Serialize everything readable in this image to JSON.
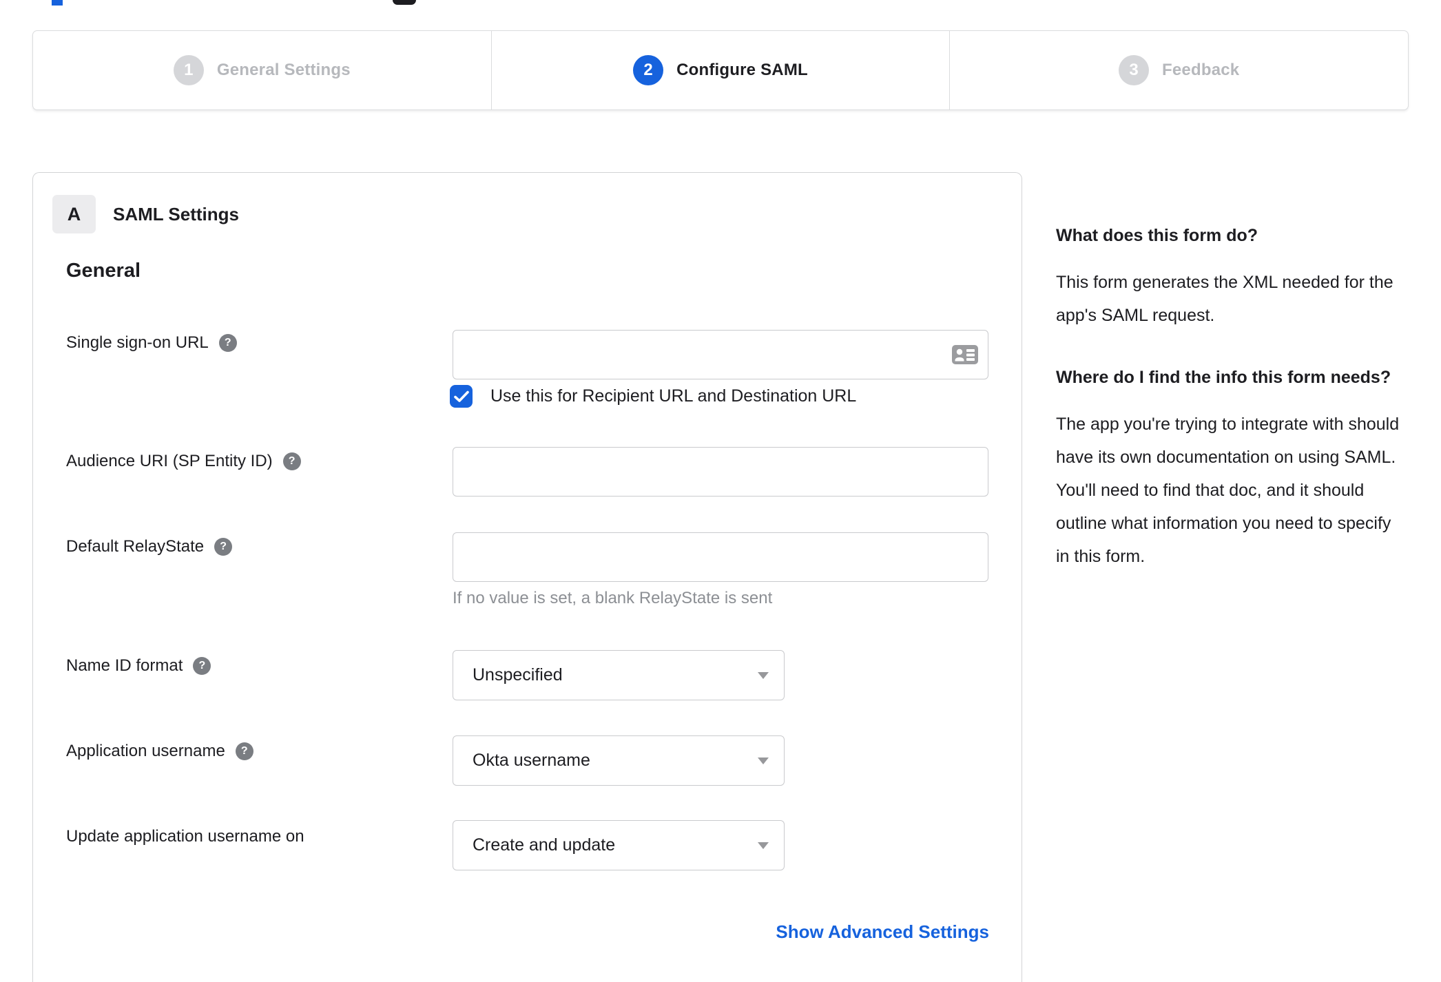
{
  "stepper": {
    "steps": [
      {
        "number": "1",
        "label": "General Settings",
        "state": "inactive"
      },
      {
        "number": "2",
        "label": "Configure SAML",
        "state": "active"
      },
      {
        "number": "3",
        "label": "Feedback",
        "state": "inactive"
      }
    ]
  },
  "card": {
    "section_badge": "A",
    "section_title": "SAML Settings",
    "group_title": "General",
    "fields": [
      {
        "label": "Single sign-on URL",
        "type": "text",
        "value": "",
        "checkbox_label": "Use this for Recipient URL and Destination URL",
        "checkbox_checked": true
      },
      {
        "label": "Audience URI (SP Entity ID)",
        "type": "text",
        "value": ""
      },
      {
        "label": "Default RelayState",
        "type": "text",
        "value": "",
        "hint": "If no value is set, a blank RelayState is sent"
      },
      {
        "label": "Name ID format",
        "type": "select",
        "value": "Unspecified"
      },
      {
        "label": "Application username",
        "type": "select",
        "value": "Okta username"
      },
      {
        "label": "Update application username on",
        "type": "select",
        "value": "Create and update"
      }
    ],
    "advanced_link": "Show Advanced Settings"
  },
  "sidebar": {
    "sections": [
      {
        "heading": "What does this form do?",
        "body": "This form generates the XML needed for the app's SAML request."
      },
      {
        "heading": "Where do I find the info this form needs?",
        "body": "The app you're trying to integrate with should have its own documentation on using SAML. You'll need to find that doc, and it should outline what information you need to specify in this form."
      }
    ]
  },
  "icons": {
    "help": "?"
  },
  "colors": {
    "accent_blue": "#1662dd",
    "inactive_circle": "#d5d6d9",
    "inactive_label": "#b6b8bc",
    "text": "#1d1d21",
    "muted": "#8c8f94"
  }
}
